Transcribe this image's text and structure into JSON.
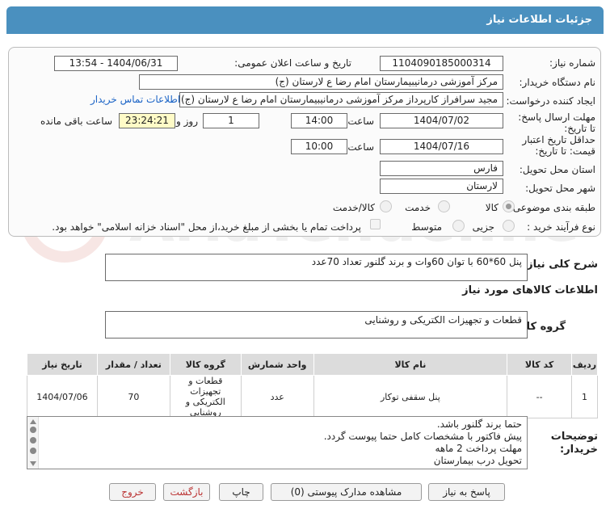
{
  "header": {
    "title": "جزئیات اطلاعات نیاز"
  },
  "fields": {
    "need_number_label": "شماره نیاز:",
    "need_number": "1104090185000314",
    "announce_label": "تاریخ و ساعت اعلان عمومی:",
    "announce_value": "1404/06/31 - 13:54",
    "buyer_org_label": "نام دستگاه خریدار:",
    "buyer_org": "مرکز آموزشی درمانیبیمارستان امام رضا  ع  لارستان (ج)",
    "creator_label": "ایجاد کننده درخواست:",
    "creator": "مجید سرافراز کارپرداز  مرکز آموزشی درمانیبیمارستان امام رضا  ع  لارستان (ج)",
    "contact_link": "اطلاعات تماس خریدار",
    "deadline_label": "مهلت ارسال پاسخ: تا تاریخ:",
    "deadline_date": "1404/07/02",
    "time_label": "ساعت",
    "deadline_time": "14:00",
    "days_value": "1",
    "days_label": "روز و",
    "remaining_time": "23:24:21",
    "remaining_label": "ساعت باقی مانده",
    "validity_label": "حداقل تاریخ اعتبار قیمت: تا تاریخ:",
    "validity_date": "1404/07/16",
    "validity_time_label": "ساعت",
    "validity_time": "10:00",
    "province_label": "استان محل تحویل:",
    "province": "فارس",
    "city_label": "شهر محل تحویل:",
    "city": "لارستان",
    "category_label": "طبقه بندی موضوعی:",
    "category_options": [
      "کالا",
      "خدمت",
      "کالا/خدمت"
    ],
    "process_label": "نوع فرآیند خرید :",
    "process_options": [
      "جزیی",
      "متوسط"
    ],
    "payment_note": "پرداخت تمام یا بخشی از مبلغ خرید،از محل \"اسناد خزانه اسلامی\" خواهد بود."
  },
  "summary": {
    "label": "شرح کلی نیاز:",
    "text": "پنل 60*60   با توان 60وات   و برند گلنور          تعداد 70عدد"
  },
  "goods": {
    "section_title": "اطلاعات کالاهای مورد نیاز",
    "group_label": "گروه کالا:",
    "group_value": "قطعات و تجهیزات الکتریکی و روشنایی"
  },
  "table": {
    "headers": [
      "ردیف",
      "کد کالا",
      "نام کالا",
      "واحد شمارش",
      "گروه کالا",
      "تعداد / مقدار",
      "تاریخ نیاز"
    ],
    "rows": [
      [
        "1",
        "--",
        "پنل سقفی توکار",
        "عدد",
        "قطعات و تجهیزات الکتریکی و روشنایی",
        "70",
        "1404/07/06"
      ]
    ]
  },
  "buyer_notes": {
    "label": "توضیحات خریدار:",
    "lines": [
      "حتما برند گلنور باشد.",
      "پیش فاکتور با مشخصات کامل حتما پیوست گردد.",
      "مهلت پرداخت 2 ماهه",
      "تحویل درب بیمارستان"
    ]
  },
  "buttons": {
    "reply": "پاسخ به نیاز",
    "view_docs": "مشاهده مدارک پیوستی (0)",
    "print": "چاپ",
    "back": "بازگشت",
    "exit": "خروج"
  },
  "watermark": "AriaTender.net"
}
